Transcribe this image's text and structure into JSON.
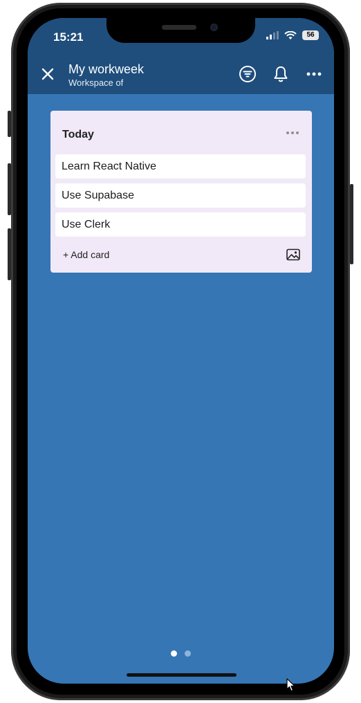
{
  "status_bar": {
    "time": "15:21",
    "battery": "56"
  },
  "header": {
    "title": "My workweek",
    "subtitle": "Workspace of"
  },
  "list": {
    "title": "Today",
    "cards": [
      "Learn React Native",
      "Use Supabase",
      "Use Clerk"
    ],
    "add_card": "+ Add card"
  },
  "pagination": {
    "count": 2,
    "active": 1
  },
  "icons": {
    "close": "close-icon",
    "filter": "filter-icon",
    "notifications": "bell-icon",
    "more": "more-horizontal-icon",
    "image": "image-icon"
  },
  "colors": {
    "board_bg": "#3676B5",
    "header_bg": "#1F4E7C",
    "list_bg": "#F1E9F7"
  }
}
